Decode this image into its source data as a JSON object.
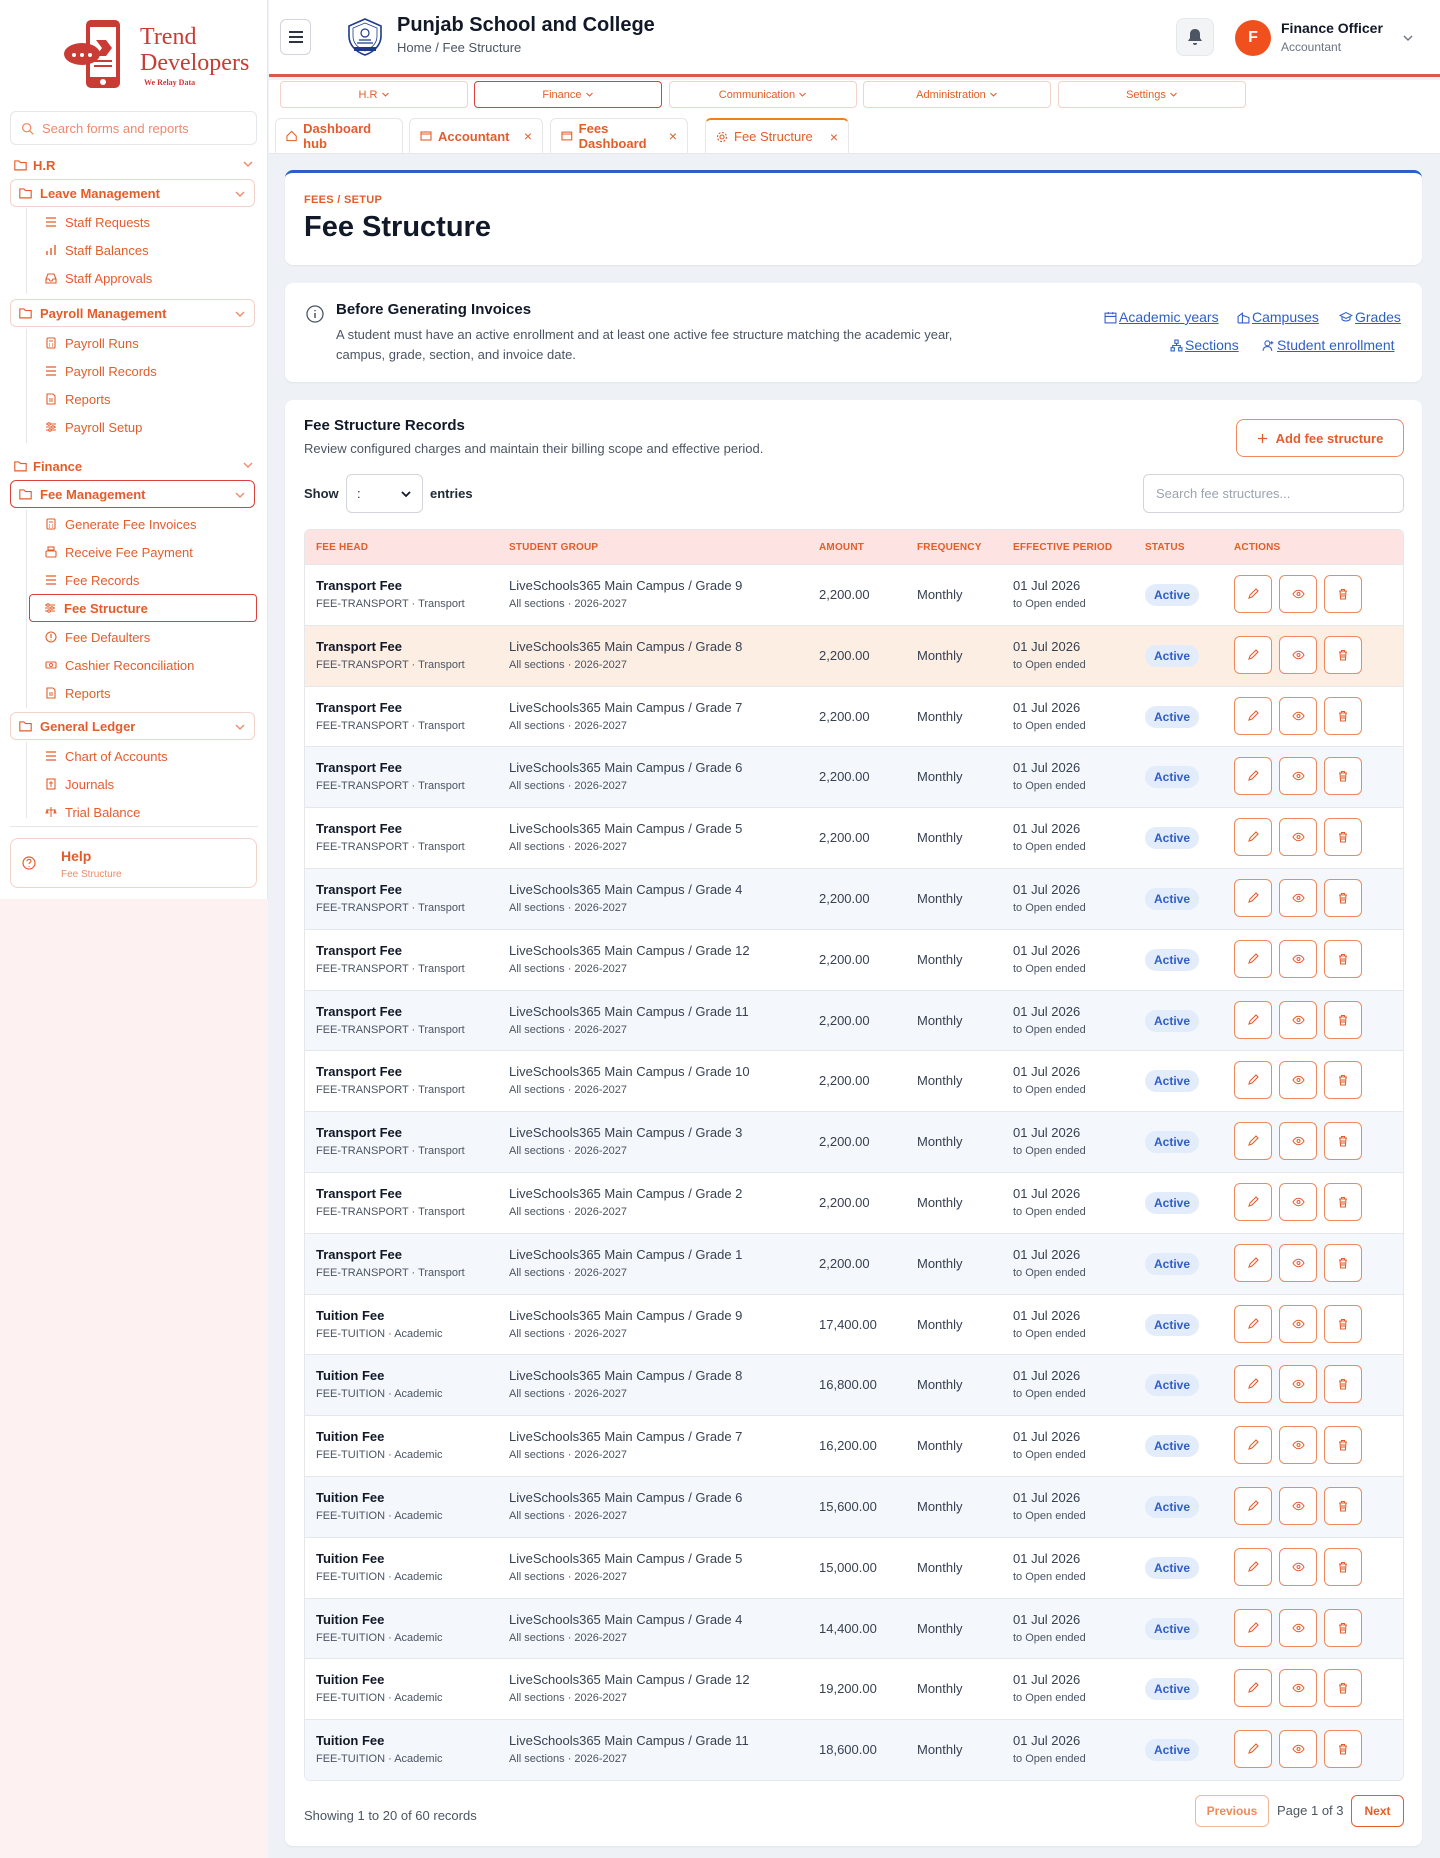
{
  "brand": {
    "line1": "Trend",
    "line2": "Developers",
    "tagline": "We Relay Data"
  },
  "sidebar": {
    "search_placeholder": "Search forms and reports",
    "sections": [
      {
        "label": "H.R"
      },
      {
        "label": "Finance"
      }
    ],
    "groups": {
      "leave": {
        "label": "Leave Management",
        "items": [
          "Staff Requests",
          "Staff Balances",
          "Staff Approvals"
        ]
      },
      "payroll": {
        "label": "Payroll Management",
        "items": [
          "Payroll Runs",
          "Payroll Records",
          "Reports",
          "Payroll Setup"
        ]
      },
      "fee": {
        "label": "Fee Management",
        "items": [
          "Generate Fee Invoices",
          "Receive Fee Payment",
          "Fee Records",
          "Fee Structure",
          "Fee Defaulters",
          "Cashier Reconciliation",
          "Reports"
        ]
      },
      "gl": {
        "label": "General Ledger",
        "items": [
          "Chart of Accounts",
          "Journals",
          "Trial Balance"
        ]
      }
    },
    "help": {
      "label": "Help",
      "sub": "Fee Structure"
    }
  },
  "header": {
    "school": "Punjab School and College",
    "breadcrumb": "Home / Fee Structure",
    "user": {
      "initial": "F",
      "name": "Finance Officer",
      "role": "Accountant"
    }
  },
  "topnav": [
    "H.R",
    "Finance",
    "Communication",
    "Administration",
    "Settings"
  ],
  "tabs": [
    {
      "label": "Dashboard hub",
      "closable": false
    },
    {
      "label": "Accountant",
      "closable": true
    },
    {
      "label": "Fees Dashboard",
      "closable": true
    },
    {
      "label": "Fee Structure",
      "closable": true
    }
  ],
  "page": {
    "eyebrow": "FEES / SETUP",
    "title": "Fee Structure"
  },
  "info": {
    "title": "Before Generating Invoices",
    "body": "A student must have an active enrollment and at least one active fee structure matching the academic year, campus, grade, section, and invoice date.",
    "links": [
      "Academic years",
      "Campuses",
      "Grades",
      "Sections",
      "Student enrollment"
    ]
  },
  "records": {
    "title": "Fee Structure Records",
    "subtitle": "Review configured charges and maintain their billing scope and effective period.",
    "add_label": "Add fee structure",
    "show_label": "Show",
    "show_value": ":",
    "entries_label": "entries",
    "search_placeholder": "Search fee structures...",
    "columns": [
      "FEE HEAD",
      "STUDENT GROUP",
      "AMOUNT",
      "FREQUENCY",
      "EFFECTIVE PERIOD",
      "STATUS",
      "ACTIONS"
    ],
    "rows": [
      {
        "head": "Transport Fee",
        "code": "FEE-TRANSPORT · Transport",
        "group": "LiveSchools365 Main Campus / Grade 9",
        "scope": "All sections · 2026-2027",
        "amount": "2,200.00",
        "freq": "Monthly",
        "start": "01 Jul 2026",
        "end": "to Open ended",
        "status": "Active"
      },
      {
        "head": "Transport Fee",
        "code": "FEE-TRANSPORT · Transport",
        "group": "LiveSchools365 Main Campus / Grade 8",
        "scope": "All sections · 2026-2027",
        "amount": "2,200.00",
        "freq": "Monthly",
        "start": "01 Jul 2026",
        "end": "to Open ended",
        "status": "Active"
      },
      {
        "head": "Transport Fee",
        "code": "FEE-TRANSPORT · Transport",
        "group": "LiveSchools365 Main Campus / Grade 7",
        "scope": "All sections · 2026-2027",
        "amount": "2,200.00",
        "freq": "Monthly",
        "start": "01 Jul 2026",
        "end": "to Open ended",
        "status": "Active"
      },
      {
        "head": "Transport Fee",
        "code": "FEE-TRANSPORT · Transport",
        "group": "LiveSchools365 Main Campus / Grade 6",
        "scope": "All sections · 2026-2027",
        "amount": "2,200.00",
        "freq": "Monthly",
        "start": "01 Jul 2026",
        "end": "to Open ended",
        "status": "Active"
      },
      {
        "head": "Transport Fee",
        "code": "FEE-TRANSPORT · Transport",
        "group": "LiveSchools365 Main Campus / Grade 5",
        "scope": "All sections · 2026-2027",
        "amount": "2,200.00",
        "freq": "Monthly",
        "start": "01 Jul 2026",
        "end": "to Open ended",
        "status": "Active"
      },
      {
        "head": "Transport Fee",
        "code": "FEE-TRANSPORT · Transport",
        "group": "LiveSchools365 Main Campus / Grade 4",
        "scope": "All sections · 2026-2027",
        "amount": "2,200.00",
        "freq": "Monthly",
        "start": "01 Jul 2026",
        "end": "to Open ended",
        "status": "Active"
      },
      {
        "head": "Transport Fee",
        "code": "FEE-TRANSPORT · Transport",
        "group": "LiveSchools365 Main Campus / Grade 12",
        "scope": "All sections · 2026-2027",
        "amount": "2,200.00",
        "freq": "Monthly",
        "start": "01 Jul 2026",
        "end": "to Open ended",
        "status": "Active"
      },
      {
        "head": "Transport Fee",
        "code": "FEE-TRANSPORT · Transport",
        "group": "LiveSchools365 Main Campus / Grade 11",
        "scope": "All sections · 2026-2027",
        "amount": "2,200.00",
        "freq": "Monthly",
        "start": "01 Jul 2026",
        "end": "to Open ended",
        "status": "Active"
      },
      {
        "head": "Transport Fee",
        "code": "FEE-TRANSPORT · Transport",
        "group": "LiveSchools365 Main Campus / Grade 10",
        "scope": "All sections · 2026-2027",
        "amount": "2,200.00",
        "freq": "Monthly",
        "start": "01 Jul 2026",
        "end": "to Open ended",
        "status": "Active"
      },
      {
        "head": "Transport Fee",
        "code": "FEE-TRANSPORT · Transport",
        "group": "LiveSchools365 Main Campus / Grade 3",
        "scope": "All sections · 2026-2027",
        "amount": "2,200.00",
        "freq": "Monthly",
        "start": "01 Jul 2026",
        "end": "to Open ended",
        "status": "Active"
      },
      {
        "head": "Transport Fee",
        "code": "FEE-TRANSPORT · Transport",
        "group": "LiveSchools365 Main Campus / Grade 2",
        "scope": "All sections · 2026-2027",
        "amount": "2,200.00",
        "freq": "Monthly",
        "start": "01 Jul 2026",
        "end": "to Open ended",
        "status": "Active"
      },
      {
        "head": "Transport Fee",
        "code": "FEE-TRANSPORT · Transport",
        "group": "LiveSchools365 Main Campus / Grade 1",
        "scope": "All sections · 2026-2027",
        "amount": "2,200.00",
        "freq": "Monthly",
        "start": "01 Jul 2026",
        "end": "to Open ended",
        "status": "Active"
      },
      {
        "head": "Tuition Fee",
        "code": "FEE-TUITION · Academic",
        "group": "LiveSchools365 Main Campus / Grade 9",
        "scope": "All sections · 2026-2027",
        "amount": "17,400.00",
        "freq": "Monthly",
        "start": "01 Jul 2026",
        "end": "to Open ended",
        "status": "Active"
      },
      {
        "head": "Tuition Fee",
        "code": "FEE-TUITION · Academic",
        "group": "LiveSchools365 Main Campus / Grade 8",
        "scope": "All sections · 2026-2027",
        "amount": "16,800.00",
        "freq": "Monthly",
        "start": "01 Jul 2026",
        "end": "to Open ended",
        "status": "Active"
      },
      {
        "head": "Tuition Fee",
        "code": "FEE-TUITION · Academic",
        "group": "LiveSchools365 Main Campus / Grade 7",
        "scope": "All sections · 2026-2027",
        "amount": "16,200.00",
        "freq": "Monthly",
        "start": "01 Jul 2026",
        "end": "to Open ended",
        "status": "Active"
      },
      {
        "head": "Tuition Fee",
        "code": "FEE-TUITION · Academic",
        "group": "LiveSchools365 Main Campus / Grade 6",
        "scope": "All sections · 2026-2027",
        "amount": "15,600.00",
        "freq": "Monthly",
        "start": "01 Jul 2026",
        "end": "to Open ended",
        "status": "Active"
      },
      {
        "head": "Tuition Fee",
        "code": "FEE-TUITION · Academic",
        "group": "LiveSchools365 Main Campus / Grade 5",
        "scope": "All sections · 2026-2027",
        "amount": "15,000.00",
        "freq": "Monthly",
        "start": "01 Jul 2026",
        "end": "to Open ended",
        "status": "Active"
      },
      {
        "head": "Tuition Fee",
        "code": "FEE-TUITION · Academic",
        "group": "LiveSchools365 Main Campus / Grade 4",
        "scope": "All sections · 2026-2027",
        "amount": "14,400.00",
        "freq": "Monthly",
        "start": "01 Jul 2026",
        "end": "to Open ended",
        "status": "Active"
      },
      {
        "head": "Tuition Fee",
        "code": "FEE-TUITION · Academic",
        "group": "LiveSchools365 Main Campus / Grade 12",
        "scope": "All sections · 2026-2027",
        "amount": "19,200.00",
        "freq": "Monthly",
        "start": "01 Jul 2026",
        "end": "to Open ended",
        "status": "Active"
      },
      {
        "head": "Tuition Fee",
        "code": "FEE-TUITION · Academic",
        "group": "LiveSchools365 Main Campus / Grade 11",
        "scope": "All sections · 2026-2027",
        "amount": "18,600.00",
        "freq": "Monthly",
        "start": "01 Jul 2026",
        "end": "to Open ended",
        "status": "Active"
      }
    ],
    "footer": {
      "count": "Showing 1 to 20 of 60 records",
      "prev": "Previous",
      "page": "Page 1 of 3",
      "next": "Next"
    }
  },
  "colors": {
    "accent": "#e35d2b",
    "brand_red": "#d9423b",
    "link_blue": "#2f5ec9",
    "badge_bg": "#e3ecfb"
  }
}
